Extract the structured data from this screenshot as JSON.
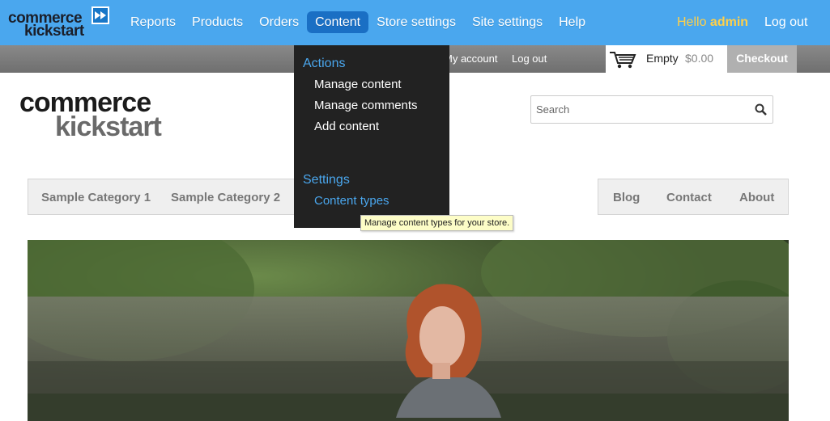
{
  "admin_bar": {
    "logo_line1": "commerce",
    "logo_line2": "kickstart",
    "nav": [
      "Reports",
      "Products",
      "Orders",
      "Content",
      "Store settings",
      "Site settings",
      "Help"
    ],
    "active_nav": "Content",
    "hello_prefix": "Hello",
    "hello_user": "admin",
    "logout": "Log out"
  },
  "user_bar": {
    "my_account": "My account",
    "logout": "Log out",
    "cart_empty": "Empty",
    "cart_amount": "$0.00",
    "checkout": "Checkout"
  },
  "site": {
    "logo_line1": "commerce",
    "logo_line2": "kickstart",
    "search_placeholder": "Search"
  },
  "main_nav_left": [
    "Sample Category 1",
    "Sample Category 2"
  ],
  "main_nav_right": [
    "Blog",
    "Contact",
    "About"
  ],
  "dropdown": {
    "actions_header": "Actions",
    "actions": [
      "Manage content",
      "Manage comments",
      "Add content"
    ],
    "settings_header": "Settings",
    "settings": [
      "Content types"
    ]
  },
  "tooltip": "Manage content types for your store.",
  "colors": {
    "admin_bar": "#4aa7ee",
    "active_tab": "#1a6fc4",
    "dropdown_bg": "#222222",
    "hello": "#ffd04a"
  }
}
